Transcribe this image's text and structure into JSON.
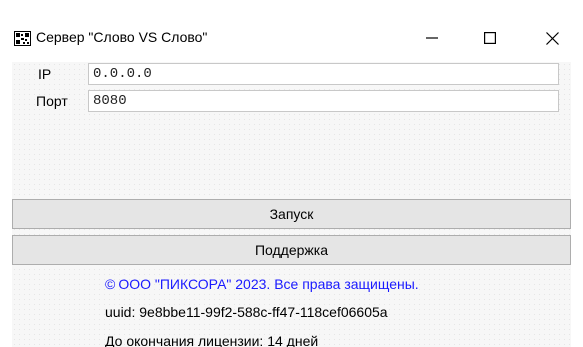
{
  "window": {
    "title": "Сервер \"Слово VS Слово\"",
    "icons": {
      "app": "qr-app-icon",
      "minimize": "minimize-icon",
      "maximize": "maximize-icon",
      "close": "close-icon"
    }
  },
  "form": {
    "ip_label": "IP",
    "ip_value": "0.0.0.0",
    "port_label": "Порт",
    "port_value": "8080"
  },
  "buttons": {
    "start_label": "Запуск",
    "support_label": "Поддержка"
  },
  "footer": {
    "copyright_symbol": "©",
    "copyright_text": "ООО \"ПИКСОРА\" 2023. Все права защищены.",
    "uuid_text": "uuid: 9e8bbe11-99f2-588c-ff47-118cef06605a",
    "license_text": "До окончания лицензии: 14 дней"
  },
  "colors": {
    "link_blue": "#1a1aff",
    "button_bg": "#e5e5e5",
    "button_border": "#adadad"
  }
}
